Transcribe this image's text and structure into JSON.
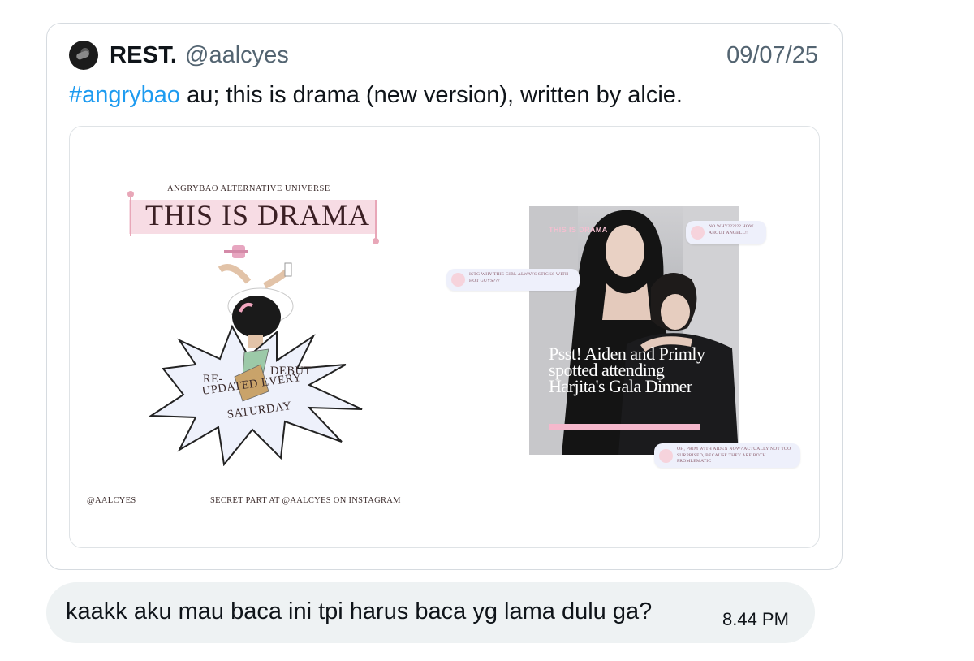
{
  "quoted_tweet": {
    "author_name": "REST.",
    "handle": "@aalcyes",
    "date": "09/07/25",
    "hashtag": "#angrybao",
    "text": " au; this is drama (new version), written by alcie."
  },
  "media_left": {
    "top_label": "ANGRYBAO ALTERNATIVE UNIVERSE",
    "title": "THIS IS DRAMA",
    "burst_re": "RE-",
    "burst_debut": "DEBUT",
    "burst_updated": "UPDATED EVERY",
    "burst_saturday": "SATURDAY",
    "footer_handle": "@AALCYES",
    "footer_secret": "SECRET PART AT @AALCYES ON INSTAGRAM"
  },
  "media_right": {
    "photo_label": "THIS IS DRAMA",
    "headline": "Psst! Aiden and Primly spotted attending Harjita's Gala Dinner",
    "comments": [
      "NO WHY?????? HOW ABOUT ANGELL!!",
      "ISTG WHY THIS GIRL ALWAYS STICKS WITH HOT GUYS???",
      "OH, PRIM WITH AIDEN NOW? ACTUALLY NOT TOO SURPRISED, BECAUSE THEY ARE BOTH PROMLEMATIC"
    ]
  },
  "reply": {
    "text": "kaakk aku mau baca ini tpi harus baca yg lama dulu ga?",
    "time": "8.44 PM"
  },
  "colors": {
    "hashtag": "#1d9bf0",
    "muted": "#536471",
    "reply_bubble": "#eef2f3",
    "poster_pink": "#f7dce4"
  }
}
